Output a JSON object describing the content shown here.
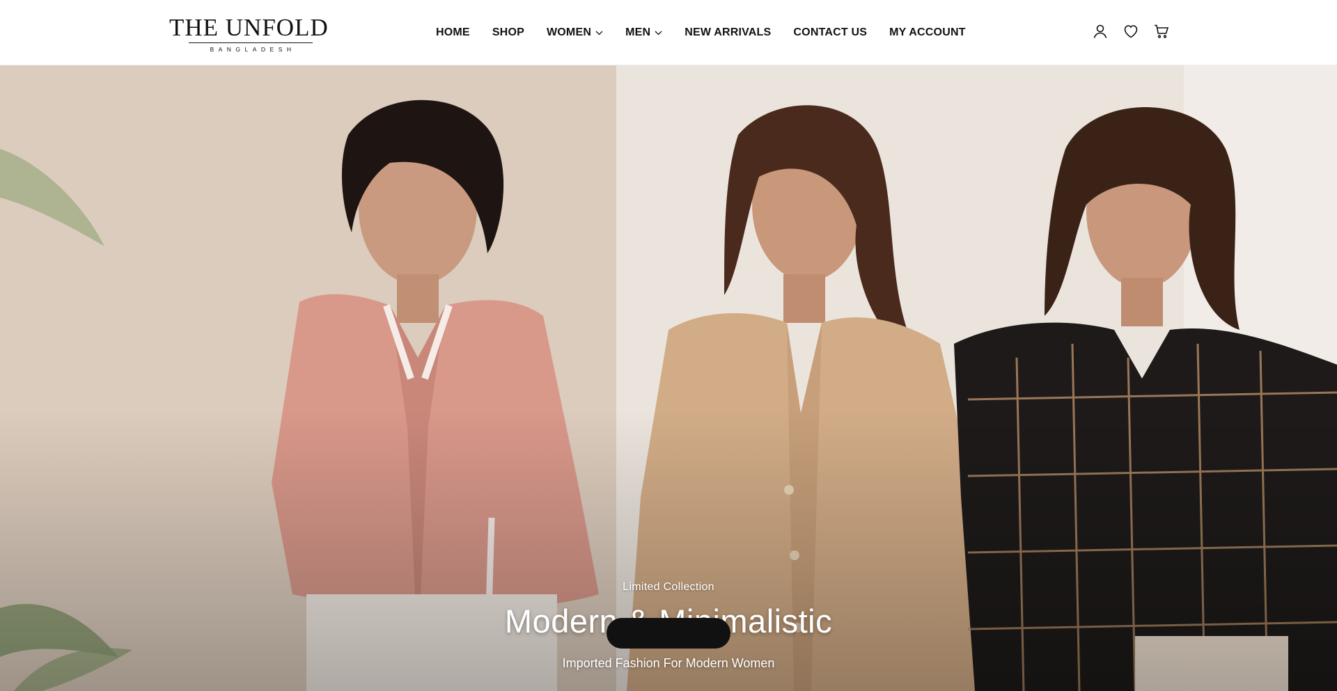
{
  "brand": {
    "name": "THE UNFOLD",
    "subtitle": "BANGLADESH"
  },
  "nav": {
    "items": [
      {
        "label": "HOME",
        "has_dropdown": false
      },
      {
        "label": "SHOP",
        "has_dropdown": false
      },
      {
        "label": "WOMEN",
        "has_dropdown": true
      },
      {
        "label": "MEN",
        "has_dropdown": true
      },
      {
        "label": "NEW ARRIVALS",
        "has_dropdown": false
      },
      {
        "label": "CONTACT US",
        "has_dropdown": false
      },
      {
        "label": "MY ACCOUNT",
        "has_dropdown": false
      }
    ]
  },
  "header_icons": [
    "user-icon",
    "heart-icon",
    "cart-icon"
  ],
  "hero": {
    "eyebrow": "Limited Collection",
    "title": "Modern & Minimalistic",
    "subtitle": "Imported Fashion For Modern Women",
    "image_subject": "three women wearing a pink blouse, a beige blazer-style shirt and a black checked shirt"
  },
  "colors": {
    "header_bg": "#ffffff",
    "text_dark": "#111111",
    "hero_text": "#ffffff",
    "cta_bg": "#111111"
  }
}
